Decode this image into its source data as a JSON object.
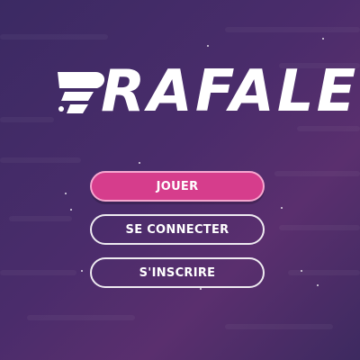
{
  "app": {
    "logo_text": "RAFALE"
  },
  "menu": {
    "play_label": "JOUER",
    "login_label": "SE CONNECTER",
    "signup_label": "S'INSCRIRE"
  },
  "colors": {
    "background_start": "#3b2a63",
    "background_end": "#5a2f6e",
    "primary_button": "#d63d8c",
    "primary_button_border": "#f6a6cf",
    "text": "#ffffff"
  }
}
